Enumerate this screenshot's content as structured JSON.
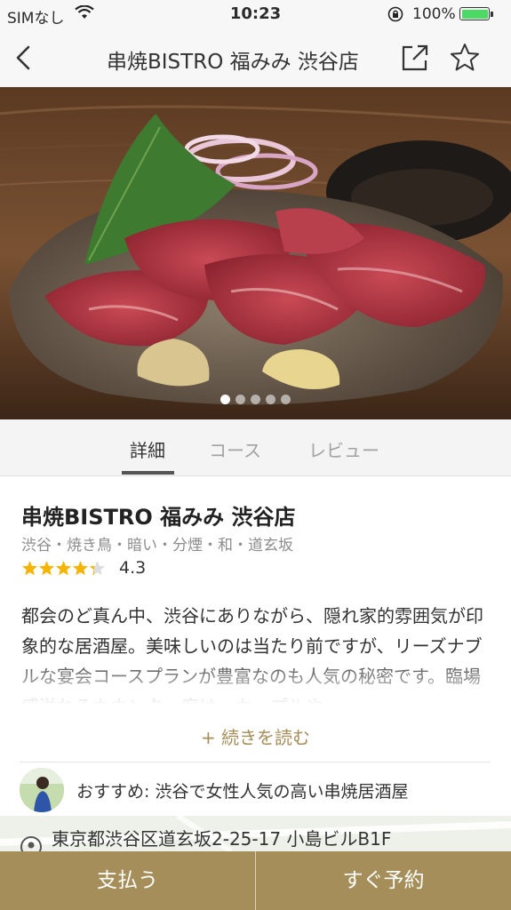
{
  "status_bar": {
    "carrier": "SIMなし",
    "time": "10:23",
    "battery": "100%",
    "battery_level": 1.0,
    "battery_color": "#4cd964"
  },
  "nav": {
    "title": "串焼BISTRO 福みみ 渋谷店",
    "icons": [
      "back-chevron-icon",
      "share-icon",
      "favorite-star-icon"
    ]
  },
  "gallery": {
    "page_count": 5,
    "current_page": 1
  },
  "tabs": [
    {
      "label": "詳細",
      "active": true
    },
    {
      "label": "コース",
      "active": false
    },
    {
      "label": "レビュー",
      "active": false
    }
  ],
  "detail": {
    "name": "串焼BISTRO 福みみ 渋谷店",
    "tags": "渋谷・焼き鳥・暗い・分煙・和・道玄坂",
    "rating": "4.3",
    "rating_stars": 4.3,
    "description": "都会のど真ん中、渋谷にありながら、隠れ家的雰囲気が印象的な居酒屋。美味しいのは当たり前ですが、リーズナブルな宴会コースプランが豊富なのも人気の秘密です。臨場感溢れるカウンター席は、カップルや",
    "read_more": "+ 続きを読む",
    "recommend": "おすすめ: 渋谷で女性人気の高い串焼居酒屋",
    "address": "東京都渋谷区道玄坂2-25-17 小島ビルB1F"
  },
  "actions": {
    "pay": "支払う",
    "reserve": "すぐ予約"
  },
  "colors": {
    "accent": "#a58e5a",
    "star": "#f5b400"
  }
}
